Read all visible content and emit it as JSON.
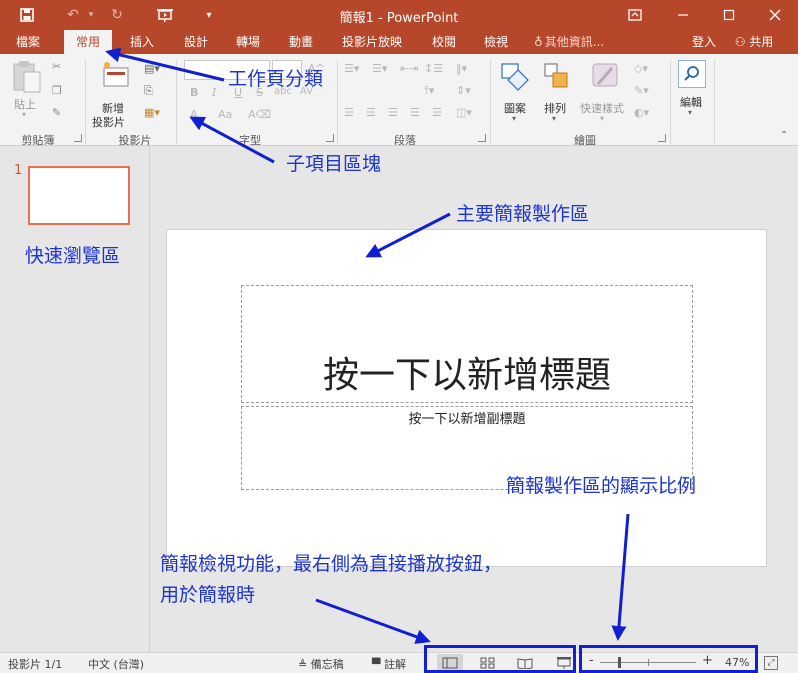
{
  "window": {
    "title": "簡報1 - PowerPoint"
  },
  "tabs": [
    "檔案",
    "常用",
    "插入",
    "設計",
    "轉場",
    "動畫",
    "投影片放映",
    "校閱",
    "檢視"
  ],
  "active_tab": "常用",
  "tell_me": "其他資訊...",
  "account": {
    "signin": "登入",
    "share": "共用"
  },
  "ribbon": {
    "clipboard": {
      "paste": "貼上",
      "label": "剪貼簿"
    },
    "slides": {
      "new_slide_line1": "新增",
      "new_slide_line2": "投影片",
      "label": "投影片"
    },
    "font": {
      "label": "字型",
      "bold": "B",
      "italic": "I",
      "underline": "U",
      "strike": "S",
      "shadow": "abc",
      "spacing": "AV",
      "size_up": "A",
      "case": "Aa"
    },
    "paragraph": {
      "label": "段落"
    },
    "drawing": {
      "shapes": "圖案",
      "arrange": "排列",
      "quick_styles": "快速樣式",
      "label": "繪圖"
    },
    "editing": {
      "label": "編輯"
    }
  },
  "thumbnail": {
    "number": "1"
  },
  "slide": {
    "title_placeholder": "按一下以新增標題",
    "subtitle_placeholder": "按一下以新增副標題"
  },
  "statusbar": {
    "slide_info": "投影片 1/1",
    "language": "中文 (台灣)",
    "notes": "備忘稿",
    "comments": "註解",
    "zoom_minus": "-",
    "zoom_plus": "+",
    "zoom": "47%"
  },
  "annotations": {
    "tabs": "工作頁分類",
    "groups": "子項目區塊",
    "main_area": "主要簡報製作區",
    "quick_browse": "快速瀏覽區",
    "zoom_ratio": "簡報製作區的顯示比例",
    "view_line1": "簡報檢視功能，最右側為直接播放按鈕，",
    "view_line2": "用於簡報時"
  },
  "colors": {
    "brand": "#b7472a",
    "annotation": "#1e34cf",
    "thumb_border": "#e8704e"
  }
}
